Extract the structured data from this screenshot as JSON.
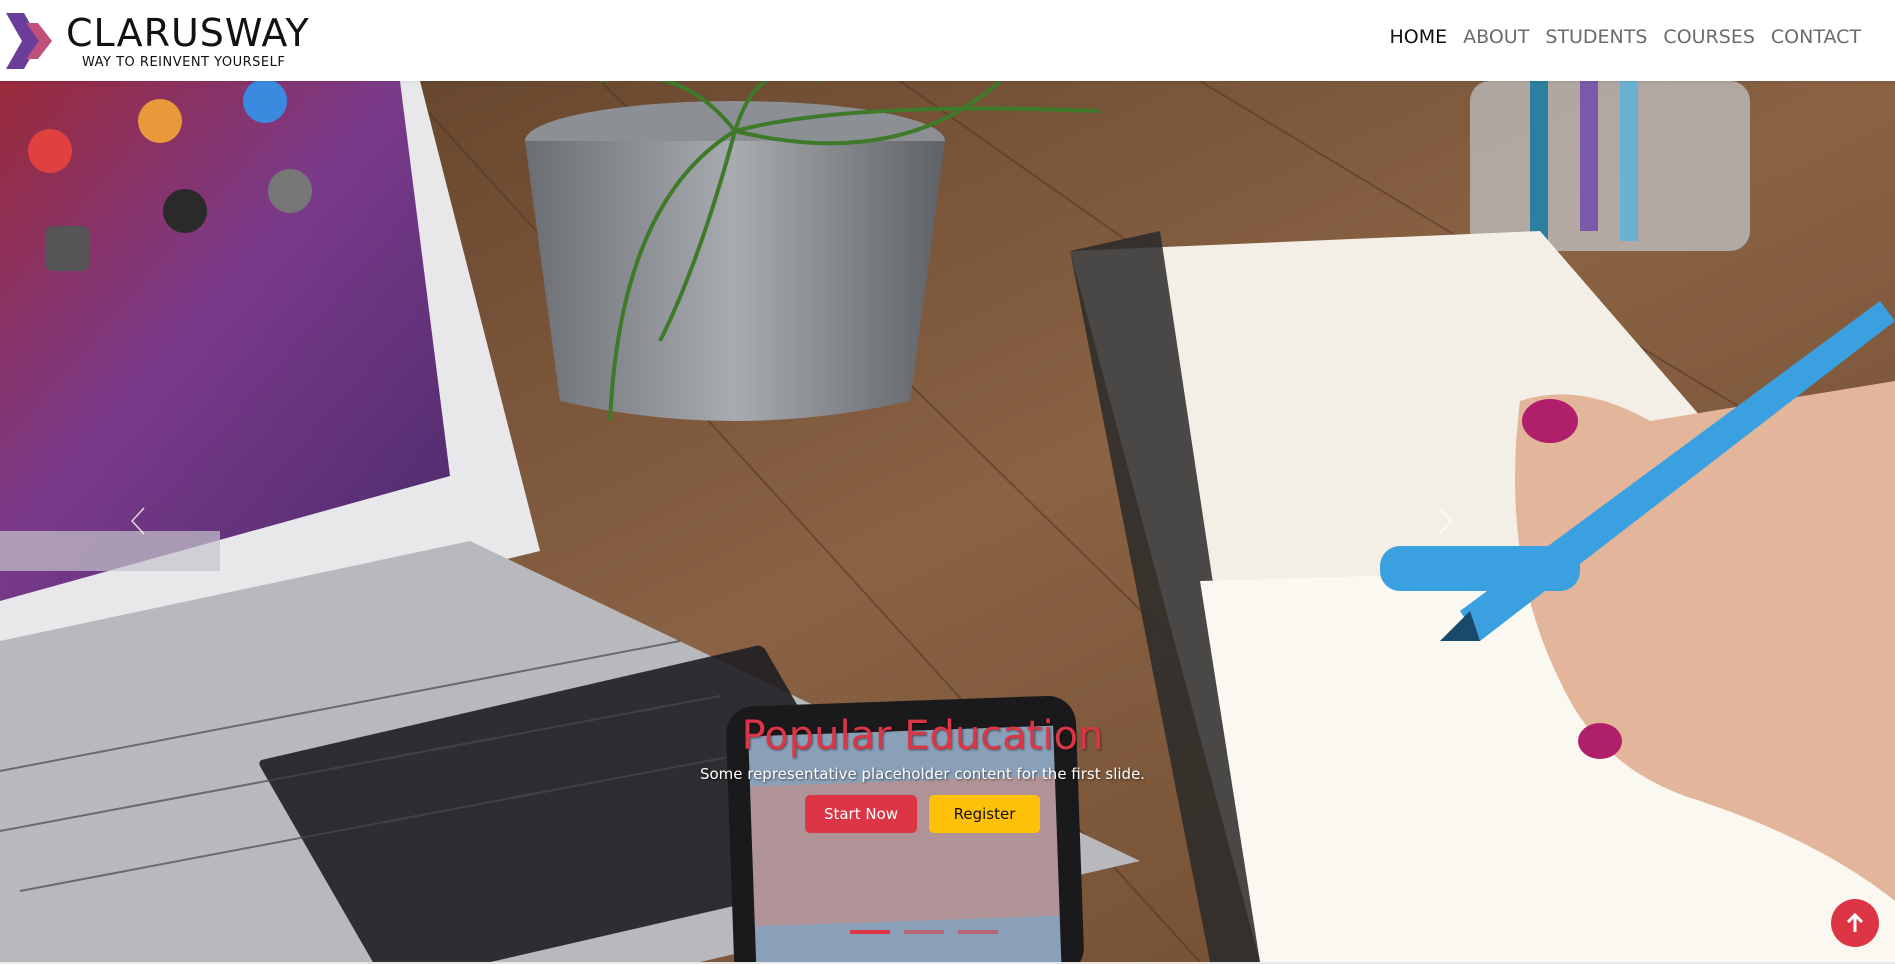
{
  "brand": {
    "title": "CLARUSWAY",
    "subtitle": "WAY TO REINVENT YOURSELF"
  },
  "nav": {
    "items": [
      {
        "label": "HOME",
        "active": true
      },
      {
        "label": "ABOUT",
        "active": false
      },
      {
        "label": "STUDENTS",
        "active": false
      },
      {
        "label": "COURSES",
        "active": false
      },
      {
        "label": "CONTACT",
        "active": false
      }
    ]
  },
  "carousel": {
    "slides": [
      {
        "title": "Popular Education",
        "text": "Some representative placeholder content for the first slide."
      }
    ],
    "indicators": 3,
    "active_index": 0,
    "prev_icon": "chevron-left-icon",
    "next_icon": "chevron-right-icon",
    "primary_button": "Start Now",
    "secondary_button": "Register"
  },
  "scroll_top": {
    "icon": "arrow-up-icon"
  },
  "colors": {
    "accent": "#dc3545",
    "warning": "#ffc107",
    "logo_purple": "#6a3d9a",
    "logo_pink": "#c0507a"
  }
}
